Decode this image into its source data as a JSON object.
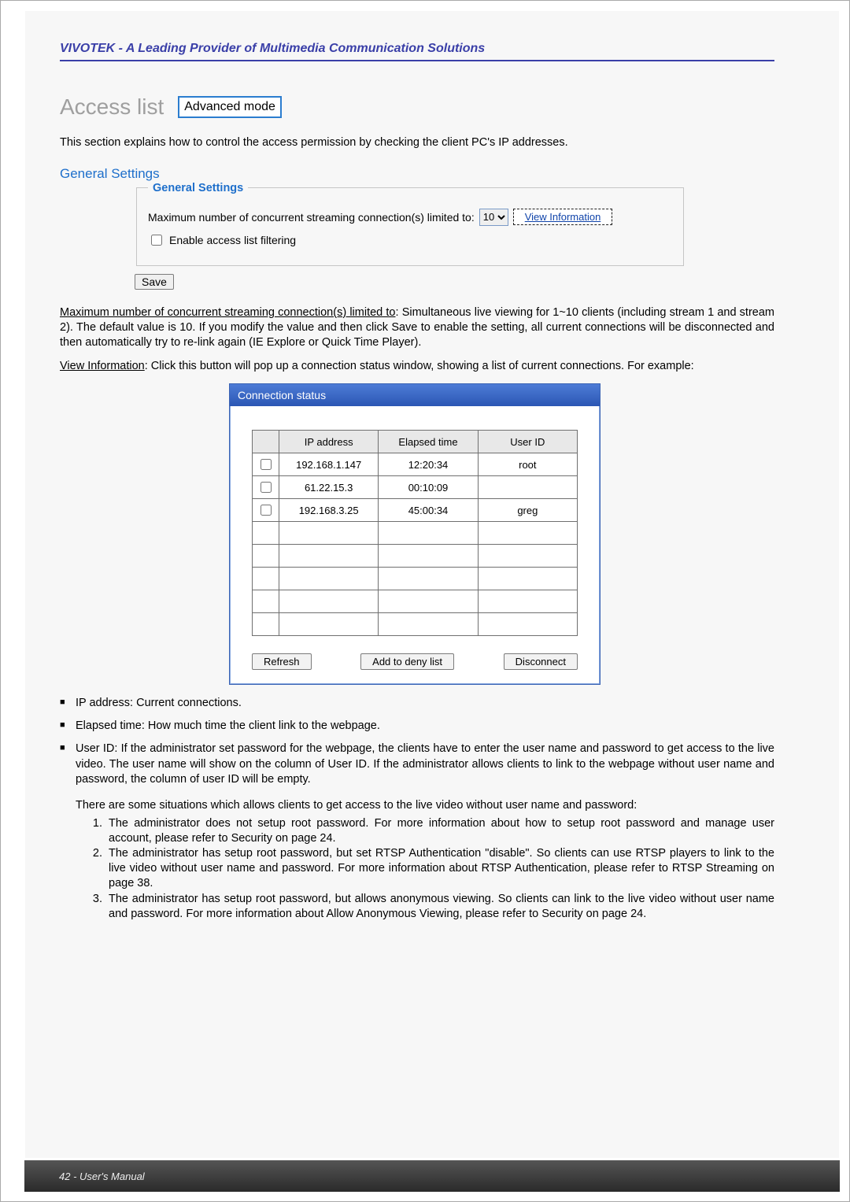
{
  "header": {
    "tagline": "VIVOTEK - A Leading Provider of Multimedia Communication Solutions"
  },
  "title": {
    "text": "Access list",
    "advanced_badge": "Advanced mode"
  },
  "intro": "This section explains how to control the access permission by checking the client PC's IP addresses.",
  "section": {
    "subtitle": "General Settings",
    "fieldset_legend": "General Settings",
    "limit_label": "Maximum number of concurrent streaming connection(s) limited to:",
    "limit_value": "10",
    "view_info_label": "View Information",
    "enable_filter_label": "Enable access list filtering",
    "save_label": "Save"
  },
  "paragraphs": {
    "p1_label": "Maximum number of concurrent streaming connection(s) limited to",
    "p1_body": ": Simultaneous live viewing for 1~10 clients (including stream 1 and stream 2). The default value is 10. If you modify the value and then click Save to enable the setting, all current connections will be disconnected and then automatically try to re-link again (IE Explore or Quick Time Player).",
    "p2_label": "View Information",
    "p2_body": ": Click this button will pop up a connection status window, showing a list of current connections. For example:"
  },
  "popup": {
    "title": "Connection status",
    "columns": [
      "",
      "IP address",
      "Elapsed time",
      "User ID"
    ],
    "rows": [
      {
        "ip": "192.168.1.147",
        "elapsed": "12:20:34",
        "user": "root"
      },
      {
        "ip": "61.22.15.3",
        "elapsed": "00:10:09",
        "user": ""
      },
      {
        "ip": "192.168.3.25",
        "elapsed": "45:00:34",
        "user": "greg"
      }
    ],
    "empty_rows": 5,
    "actions": {
      "refresh": "Refresh",
      "add_deny": "Add to deny list",
      "disconnect": "Disconnect"
    }
  },
  "bullets": {
    "b1": "IP address: Current connections.",
    "b2": "Elapsed time: How much time the client link to the webpage.",
    "b3": "User ID: If the administrator set password for the webpage, the clients have to enter the user name and password to get access to the live video. The user name will show on the column of User ID. If the administrator allows clients to link to the webpage without user name and password, the column of user ID will be empty.",
    "b3_sub_intro": "There are some situations which allows clients to get access to the live video without user name and password:",
    "b3_sub": [
      "The administrator does not setup root password. For more information about how to setup root password and manage user account, please refer to Security on page 24.",
      "The administrator has setup root password, but set RTSP Authentication   \"disable\". So clients can use RTSP players to link to the live video without user name and password. For more information about RTSP Authentication,   please refer to RTSP Streaming on page 38.",
      "The administrator has setup root password, but allows anonymous viewing. So clients can link to the live video without user name and password. For more information about Allow Anonymous Viewing,  please refer to Security on page 24."
    ]
  },
  "footer": "42 - User's Manual"
}
